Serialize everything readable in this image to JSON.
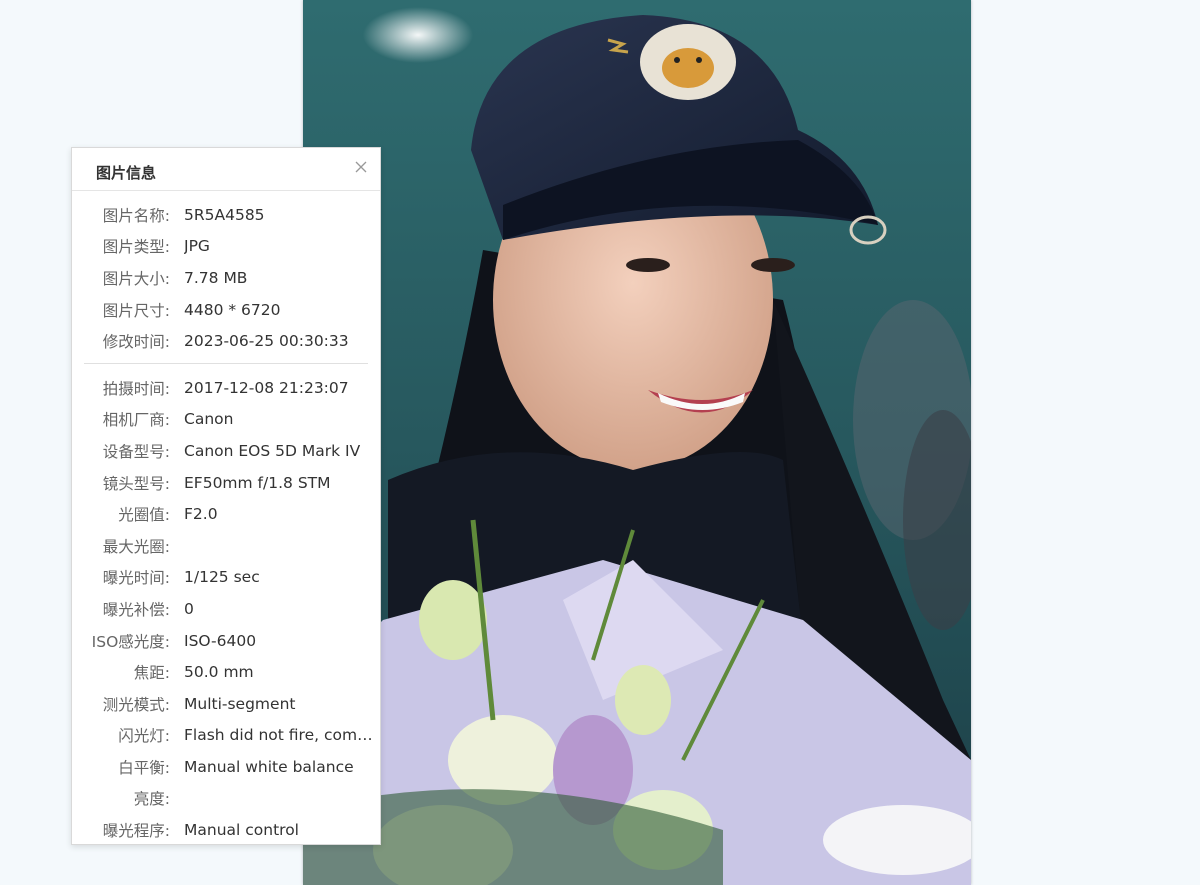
{
  "panel": {
    "title": "图片信息",
    "close_icon": "close-icon",
    "basic": [
      {
        "label": "图片名称:",
        "value": "5R5A4585"
      },
      {
        "label": "图片类型:",
        "value": "JPG"
      },
      {
        "label": "图片大小:",
        "value": "7.78 MB"
      },
      {
        "label": "图片尺寸:",
        "value": "4480 * 6720"
      },
      {
        "label": "修改时间:",
        "value": "2023-06-25 00:30:33"
      }
    ],
    "exif": [
      {
        "label": "拍摄时间:",
        "value": "2017-12-08 21:23:07"
      },
      {
        "label": "相机厂商:",
        "value": "Canon"
      },
      {
        "label": "设备型号:",
        "value": "Canon EOS 5D Mark IV"
      },
      {
        "label": "镜头型号:",
        "value": "EF50mm f/1.8 STM"
      },
      {
        "label": "光圈值:",
        "value": "F2.0"
      },
      {
        "label": "最大光圈:",
        "value": ""
      },
      {
        "label": "曝光时间:",
        "value": "1/125 sec"
      },
      {
        "label": "曝光补偿:",
        "value": "0"
      },
      {
        "label": "ISO感光度:",
        "value": "ISO-6400"
      },
      {
        "label": "焦距:",
        "value": "50.0 mm"
      },
      {
        "label": "测光模式:",
        "value": "Multi-segment"
      },
      {
        "label": "闪光灯:",
        "value": "Flash did not fire, comp..."
      },
      {
        "label": "白平衡:",
        "value": "Manual white balance"
      },
      {
        "label": "亮度:",
        "value": ""
      },
      {
        "label": "曝光程序:",
        "value": "Manual control"
      }
    ]
  }
}
